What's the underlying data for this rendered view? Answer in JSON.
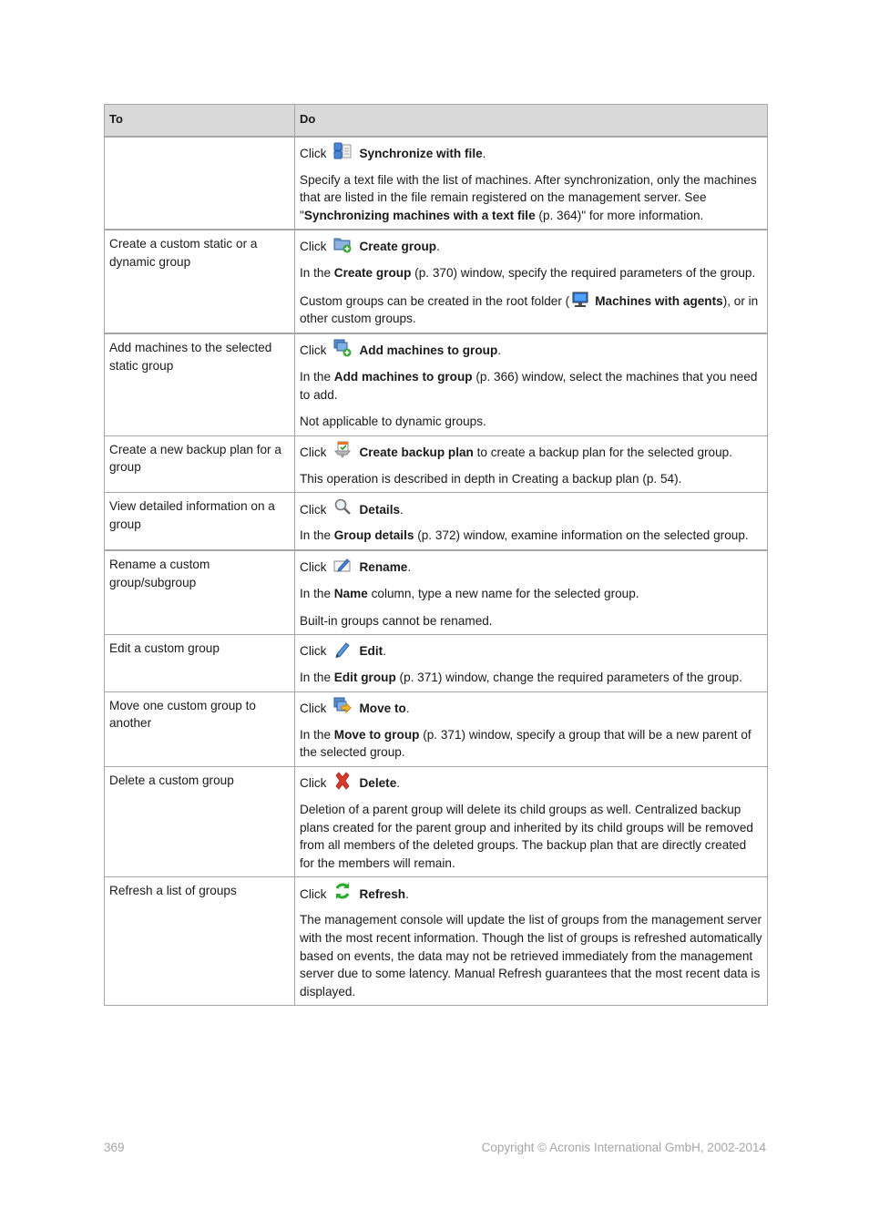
{
  "table": {
    "headers": {
      "to": "To",
      "do": "Do"
    },
    "rows": [
      {
        "to": "",
        "click_prefix": "Click",
        "action": "Synchronize with file",
        "icon": "synchronize-file-icon",
        "paragraphs": [
          {
            "pre": "Specify a text file with the list of machines. After synchronization, only the machines that are listed in the file remain registered on the management server. See \"",
            "bold": "Synchronizing machines with a text file",
            "post": " (p. 364)\" for more information."
          }
        ]
      },
      {
        "to": "Create a custom static or a dynamic group",
        "click_prefix": "Click",
        "action": "Create group",
        "icon": "create-group-icon",
        "paragraphs": [
          {
            "pre": "In the ",
            "bold": "Create group",
            "post": " (p. 370) window, specify the required parameters of the group."
          },
          {
            "pre": "Custom groups can be created in the root folder (",
            "icon": "machines-with-agents-icon",
            "bold": "Machines with agents",
            "post": "), or in other custom groups."
          }
        ]
      },
      {
        "to": "Add machines to the selected static group",
        "click_prefix": "Click",
        "action": "Add machines to group",
        "icon": "add-machines-icon",
        "paragraphs": [
          {
            "pre": "In the ",
            "bold": "Add machines to group",
            "post": " (p. 366) window, select the machines that you need to add."
          },
          {
            "pre": "Not applicable to dynamic groups.",
            "bold": "",
            "post": ""
          }
        ]
      },
      {
        "to": "Create a new backup plan for a group",
        "click_prefix": "Click",
        "action": "Create backup plan",
        "action_suffix": " to create a backup plan for the selected group.",
        "icon": "create-backup-plan-icon",
        "paragraphs": [
          {
            "pre": "This operation is described in depth in Creating a backup plan (p. 54).",
            "bold": "",
            "post": ""
          }
        ]
      },
      {
        "to": "View detailed information on a group",
        "click_prefix": "Click",
        "action": "Details",
        "icon": "magnifier-icon",
        "paragraphs": [
          {
            "pre": "In the ",
            "bold": "Group details",
            "post": " (p. 372) window, examine information on the selected group."
          }
        ]
      },
      {
        "to": "Rename a custom group/subgroup",
        "click_prefix": "Click",
        "action": "Rename",
        "icon": "rename-icon",
        "paragraphs": [
          {
            "pre": "In the ",
            "bold": "Name",
            "post": " column, type a new name for the selected group."
          },
          {
            "pre": "Built-in groups cannot be renamed.",
            "bold": "",
            "post": ""
          }
        ]
      },
      {
        "to": "Edit a custom group",
        "click_prefix": "Click",
        "action": "Edit",
        "icon": "pencil-icon",
        "paragraphs": [
          {
            "pre": "In the ",
            "bold": "Edit group",
            "post": " (p. 371) window, change the required parameters of the group."
          }
        ]
      },
      {
        "to": "Move one custom group to another",
        "click_prefix": "Click",
        "action": "Move to",
        "icon": "move-to-icon",
        "paragraphs": [
          {
            "pre": "In the ",
            "bold": "Move to group",
            "post": " (p. 371) window, specify a group that will be a new parent of the selected group."
          }
        ]
      },
      {
        "to": "Delete a custom group",
        "click_prefix": "Click",
        "action": "Delete",
        "icon": "delete-x-icon",
        "paragraphs": [
          {
            "pre": "Deletion of a parent group will delete its child groups as well. Centralized backup plans created for the parent group and inherited by its child groups will be removed from all members of the deleted groups. The backup plan that are directly created for the members will remain.",
            "bold": "",
            "post": ""
          }
        ]
      },
      {
        "to": "Refresh a list of groups",
        "click_prefix": "Click",
        "action": "Refresh",
        "icon": "refresh-icon",
        "paragraphs": [
          {
            "pre": "The management console will update the list of groups from the management server with the most recent information. Though the list of groups is refreshed automatically based on events, the data may not be retrieved immediately from the management server due to some latency. Manual Refresh guarantees that the most recent data is displayed.",
            "bold": "",
            "post": ""
          }
        ]
      }
    ]
  },
  "footer": {
    "page_number": "369",
    "copyright": "Copyright © Acronis International GmbH, 2002-2014"
  }
}
